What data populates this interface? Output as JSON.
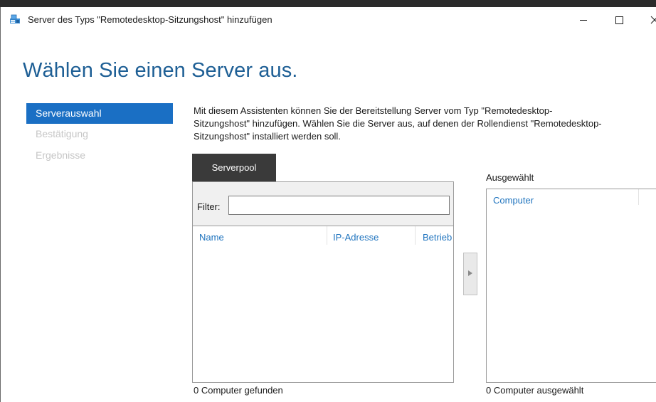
{
  "window": {
    "title": "Server des Typs \"Remotedesktop-Sitzungshost\" hinzufügen",
    "icon": "server-add-icon"
  },
  "page": {
    "heading": "Wählen Sie einen Server aus."
  },
  "nav": {
    "items": [
      {
        "label": "Serverauswahl",
        "state": "active"
      },
      {
        "label": "Bestätigung",
        "state": "disabled"
      },
      {
        "label": "Ergebnisse",
        "state": "disabled"
      }
    ]
  },
  "description": {
    "lines": [
      "Mit diesem Assistenten können Sie der Bereitstellung Server vom Typ \"Remotedesktop-",
      "Sitzungshost\" hinzufügen. Wählen Sie die Server aus, auf denen der Rollendienst \"Remotedesktop-",
      "Sitzungshost\" installiert werden soll."
    ]
  },
  "server_pool": {
    "tab_label": "Serverpool",
    "filter_label": "Filter:",
    "filter_value": "",
    "columns": [
      "Name",
      "IP-Adresse",
      "Betrieb"
    ],
    "rows": [],
    "count_text": "0 Computer gefunden"
  },
  "selected": {
    "label": "Ausgewählt",
    "columns": [
      "Computer"
    ],
    "rows": [],
    "count_text": "0 Computer ausgewählt"
  },
  "colors": {
    "accent": "#1a6fc4",
    "heading": "#1e5f95",
    "column_header": "#1e73be",
    "disabled_text": "#c6c6c6",
    "tab_dark": "#3a3a3a"
  }
}
